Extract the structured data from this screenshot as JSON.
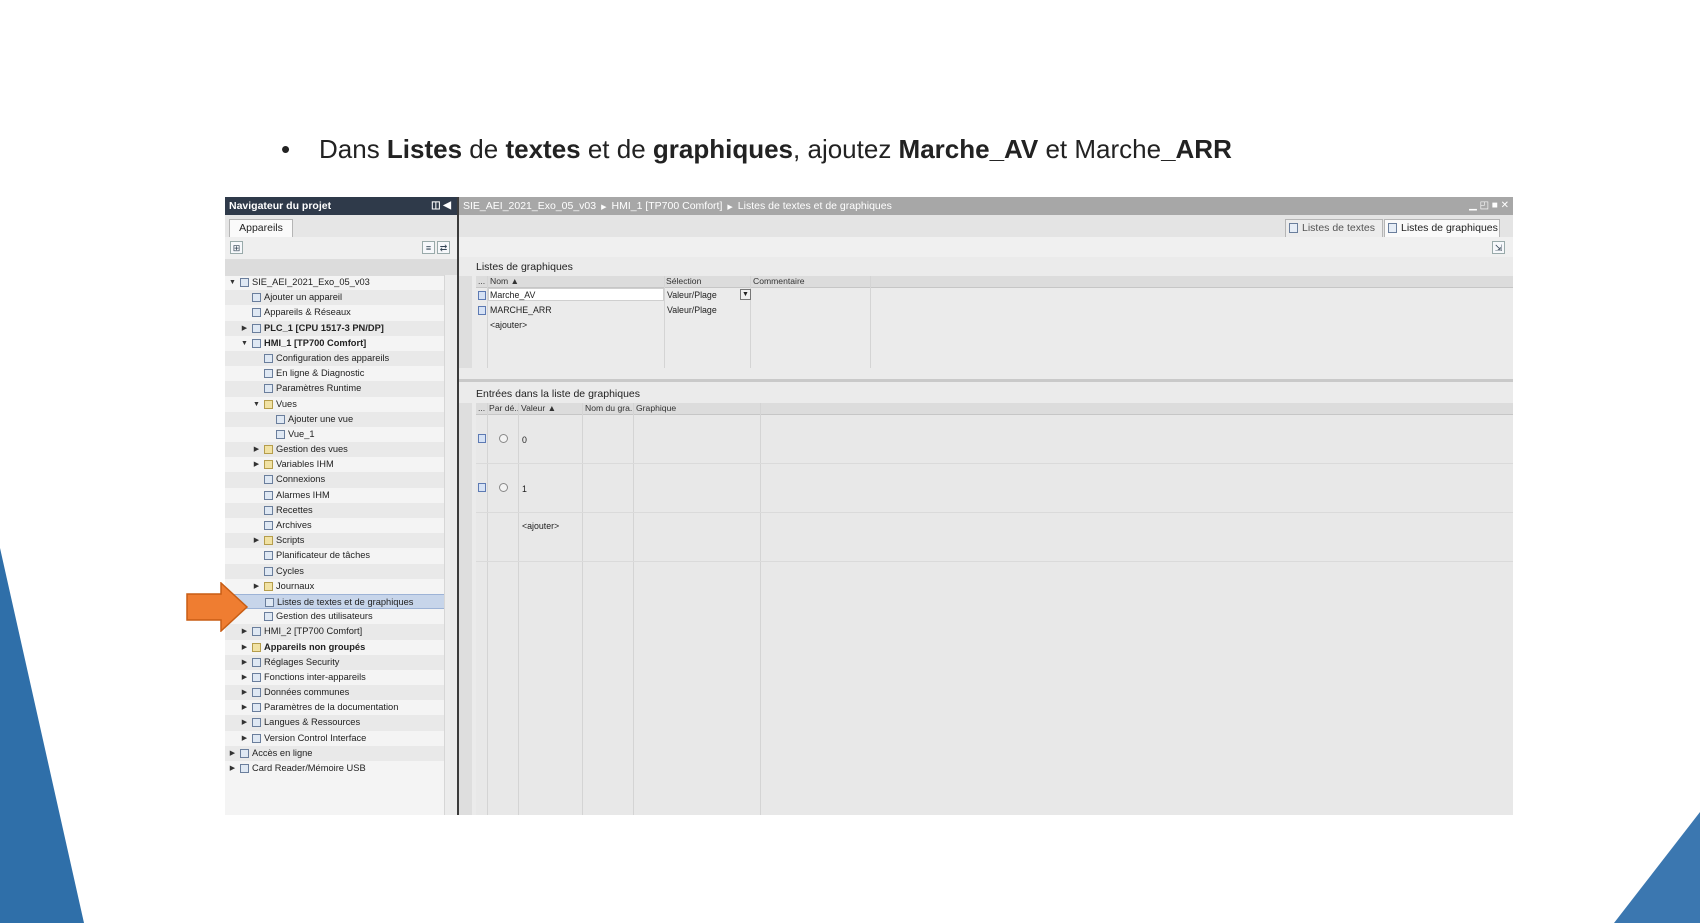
{
  "instruction": {
    "bullet": "•",
    "t1": "Dans ",
    "b1": "Listes",
    "t2": " de ",
    "b2": "textes",
    "t3": " et de ",
    "b3": "graphiques",
    "t4": ", ajoutez ",
    "b4": "Marche_AV",
    "t5": " et Marche",
    "b5": "_ARR"
  },
  "navigator": {
    "title": "Navigateur du projet",
    "tab": "Appareils",
    "tree": [
      {
        "label": "SIE_AEI_2021_Exo_05_v03",
        "level": 0,
        "arrow": "▼",
        "icon": "project-icon"
      },
      {
        "label": "Ajouter un appareil",
        "level": 1,
        "arrow": "",
        "icon": "add-device-icon"
      },
      {
        "label": "Appareils & Réseaux",
        "level": 1,
        "arrow": "",
        "icon": "network-icon"
      },
      {
        "label": "PLC_1 [CPU 1517-3 PN/DP]",
        "level": 1,
        "arrow": "▶",
        "icon": "plc-icon",
        "bold": true
      },
      {
        "label": "HMI_1 [TP700 Comfort]",
        "level": 1,
        "arrow": "▼",
        "icon": "hmi-icon",
        "bold": true
      },
      {
        "label": "Configuration des appareils",
        "level": 2,
        "arrow": "",
        "icon": "device-config-icon"
      },
      {
        "label": "En ligne & Diagnostic",
        "level": 2,
        "arrow": "",
        "icon": "diagnostic-icon"
      },
      {
        "label": "Paramètres Runtime",
        "level": 2,
        "arrow": "",
        "icon": "runtime-icon"
      },
      {
        "label": "Vues",
        "level": 2,
        "arrow": "▼",
        "icon": "folder-icon"
      },
      {
        "label": "Ajouter une vue",
        "level": 3,
        "arrow": "",
        "icon": "add-screen-icon"
      },
      {
        "label": "Vue_1",
        "level": 3,
        "arrow": "",
        "icon": "screen-icon"
      },
      {
        "label": "Gestion des vues",
        "level": 2,
        "arrow": "▶",
        "icon": "folder-icon"
      },
      {
        "label": "Variables IHM",
        "level": 2,
        "arrow": "▶",
        "icon": "folder-icon"
      },
      {
        "label": "Connexions",
        "level": 2,
        "arrow": "",
        "icon": "connections-icon"
      },
      {
        "label": "Alarmes IHM",
        "level": 2,
        "arrow": "",
        "icon": "alarm-icon"
      },
      {
        "label": "Recettes",
        "level": 2,
        "arrow": "",
        "icon": "recipe-icon"
      },
      {
        "label": "Archives",
        "level": 2,
        "arrow": "",
        "icon": "archive-icon"
      },
      {
        "label": "Scripts",
        "level": 2,
        "arrow": "▶",
        "icon": "folder-icon"
      },
      {
        "label": "Planificateur de tâches",
        "level": 2,
        "arrow": "",
        "icon": "scheduler-icon"
      },
      {
        "label": "Cycles",
        "level": 2,
        "arrow": "",
        "icon": "cycle-icon"
      },
      {
        "label": "Journaux",
        "level": 2,
        "arrow": "▶",
        "icon": "folder-icon"
      },
      {
        "label": "Listes de textes et de graphiques",
        "level": 2,
        "arrow": "",
        "icon": "text-graphic-list-icon",
        "selected": true
      },
      {
        "label": "Gestion des utilisateurs",
        "level": 2,
        "arrow": "",
        "icon": "user-admin-icon"
      },
      {
        "label": "HMI_2 [TP700 Comfort]",
        "level": 1,
        "arrow": "▶",
        "icon": "hmi-icon"
      },
      {
        "label": "Appareils non groupés",
        "level": 1,
        "arrow": "▶",
        "icon": "folder-icon",
        "bold": true
      },
      {
        "label": "Réglages Security",
        "level": 1,
        "arrow": "▶",
        "icon": "security-icon"
      },
      {
        "label": "Fonctions inter-appareils",
        "level": 1,
        "arrow": "▶",
        "icon": "cross-device-icon"
      },
      {
        "label": "Données communes",
        "level": 1,
        "arrow": "▶",
        "icon": "common-data-icon"
      },
      {
        "label": "Paramètres de la documentation",
        "level": 1,
        "arrow": "▶",
        "icon": "documentation-icon"
      },
      {
        "label": "Langues & Ressources",
        "level": 1,
        "arrow": "▶",
        "icon": "languages-icon"
      },
      {
        "label": "Version Control Interface",
        "level": 1,
        "arrow": "▶",
        "icon": "version-control-icon"
      },
      {
        "label": "Accès en ligne",
        "level": 0,
        "arrow": "▶",
        "icon": "online-access-icon"
      },
      {
        "label": "Card Reader/Mémoire USB",
        "level": 0,
        "arrow": "▶",
        "icon": "card-reader-icon"
      }
    ]
  },
  "editor": {
    "breadcrumb": [
      "SIE_AEI_2021_Exo_05_v03",
      "HMI_1 [TP700 Comfort]",
      "Listes de textes et de graphiques"
    ],
    "breadcrumb_sep": "▶",
    "tabs": [
      "Listes de textes",
      "Listes de graphiques"
    ],
    "graphic_lists": {
      "title": "Listes de graphiques",
      "columns": [
        "...",
        "Nom ▲",
        "Sélection",
        "Commentaire"
      ],
      "rows": [
        {
          "name": "Marche_AV",
          "selection": "Valeur/Plage"
        },
        {
          "name": "MARCHE_ARR",
          "selection": "Valeur/Plage"
        }
      ],
      "add": "<ajouter>"
    },
    "entries": {
      "title": "Entrées dans la liste de graphiques",
      "columns": [
        "...",
        "Par dé..",
        "Valeur ▲",
        "Nom du gra..",
        "Graphique"
      ],
      "rows": [
        {
          "value": "0"
        },
        {
          "value": "1"
        }
      ],
      "add": "<ajouter>"
    }
  },
  "colors": {
    "pointer_arrow": "#ef7d31",
    "triangle": "#3b77b0",
    "nav_title_bg": "#2f3a4a"
  }
}
